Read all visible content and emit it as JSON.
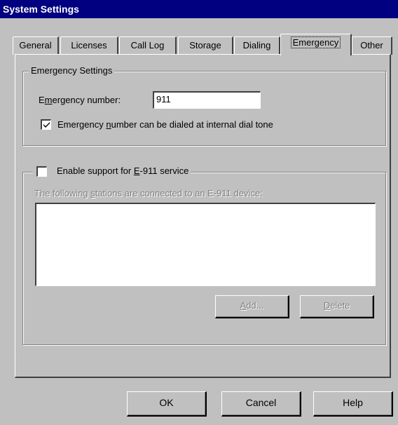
{
  "window": {
    "title": "System Settings"
  },
  "tabs": [
    {
      "label": "General"
    },
    {
      "label": "Licenses"
    },
    {
      "label": "Call Log"
    },
    {
      "label": "Storage"
    },
    {
      "label": "Dialing"
    },
    {
      "label": "Emergency",
      "selected": true
    },
    {
      "label": "Other"
    }
  ],
  "emergency_settings": {
    "group_label": "Emergency Settings",
    "number_label_prefix": "E",
    "number_label_mnemonic": "m",
    "number_label_rest": "ergency number:",
    "number_value": "911",
    "internal_dial_checkbox": {
      "checked": true,
      "label_prefix": "Emergency ",
      "label_mnemonic": "n",
      "label_rest": "umber can be dialed at internal dial tone"
    }
  },
  "e911": {
    "enable_checkbox": {
      "checked": false,
      "label_prefix": "Enable support for ",
      "label_mnemonic": "E",
      "label_rest": "-911 service"
    },
    "stations_label_prefix": "The following ",
    "stations_label_mnemonic": "s",
    "stations_label_rest": "tations are connected to an E-911 device:",
    "stations": [],
    "add_button": {
      "mnemonic": "A",
      "rest": "dd..."
    },
    "delete_button": {
      "mnemonic": "D",
      "rest": "elete"
    }
  },
  "footer": {
    "ok_label": "OK",
    "cancel_label": "Cancel",
    "help_label": "Help"
  }
}
